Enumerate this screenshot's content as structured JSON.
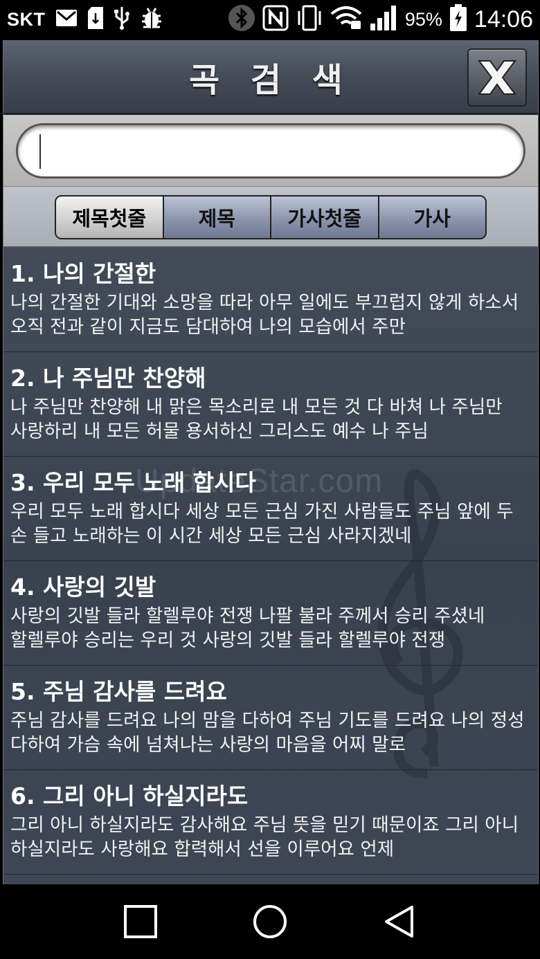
{
  "status_bar": {
    "carrier": "SKT",
    "battery_percent": "95%",
    "time": "14:06",
    "icons": [
      "mail-icon",
      "sd-card-icon",
      "usb-icon",
      "bug-icon",
      "bluetooth-icon",
      "nfc-icon",
      "vibrate-icon",
      "wifi-icon",
      "signal-icon",
      "battery-charging-icon"
    ]
  },
  "header": {
    "title": "곡 검 색",
    "close_icon": "close-x-icon"
  },
  "search": {
    "value": "",
    "placeholder": ""
  },
  "tabs": [
    {
      "label": "제목첫줄",
      "active": true
    },
    {
      "label": "제목",
      "active": false
    },
    {
      "label": "가사첫줄",
      "active": false
    },
    {
      "label": "가사",
      "active": false
    }
  ],
  "songs": [
    {
      "title": "1. 나의 간절한",
      "lyrics": "나의 간절한 기대와 소망을 따라 아무 일에도 부끄럽지 않게 하소서 오직 전과 같이 지금도 담대하여 나의 모습에서 주만"
    },
    {
      "title": "2. 나 주님만 찬양해",
      "lyrics": "나 주님만 찬양해 내 맑은 목소리로 내 모든 것 다 바쳐 나 주님만 사랑하리 내 모든 허물 용서하신 그리스도 예수 나 주님"
    },
    {
      "title": "3. 우리 모두 노래 합시다",
      "lyrics": "우리 모두 노래 합시다 세상 모든 근심 가진 사람들도 주님 앞에 두 손 들고 노래하는 이 시간 세상 모든 근심 사라지겠네"
    },
    {
      "title": "4. 사랑의 깃발",
      "lyrics": "사랑의 깃발 들라 할렐루야 전쟁 나팔 불라 주께서 승리 주셨네 할렐루야 승리는 우리 것 사랑의 깃발 들라 할렐루야 전쟁"
    },
    {
      "title": "5. 주님 감사를 드려요",
      "lyrics": "주님 감사를 드려요 나의 맘을 다하여 주님 기도를 드려요 나의 정성 다하여 가슴 속에 넘쳐나는 사랑의 마음을 어찌 말로"
    },
    {
      "title": "6. 그리 아니 하실지라도",
      "lyrics": "그리 아니 하실지라도 감사해요 주님 뜻을 믿기 때문이죠 그리 아니 하실지라도 사랑해요 합력해서 선을 이루어요 언제"
    }
  ],
  "watermark": "UpdateStar.com",
  "navigation": {
    "recents_icon": "square-icon",
    "home_icon": "circle-icon",
    "back_icon": "triangle-back-icon"
  }
}
